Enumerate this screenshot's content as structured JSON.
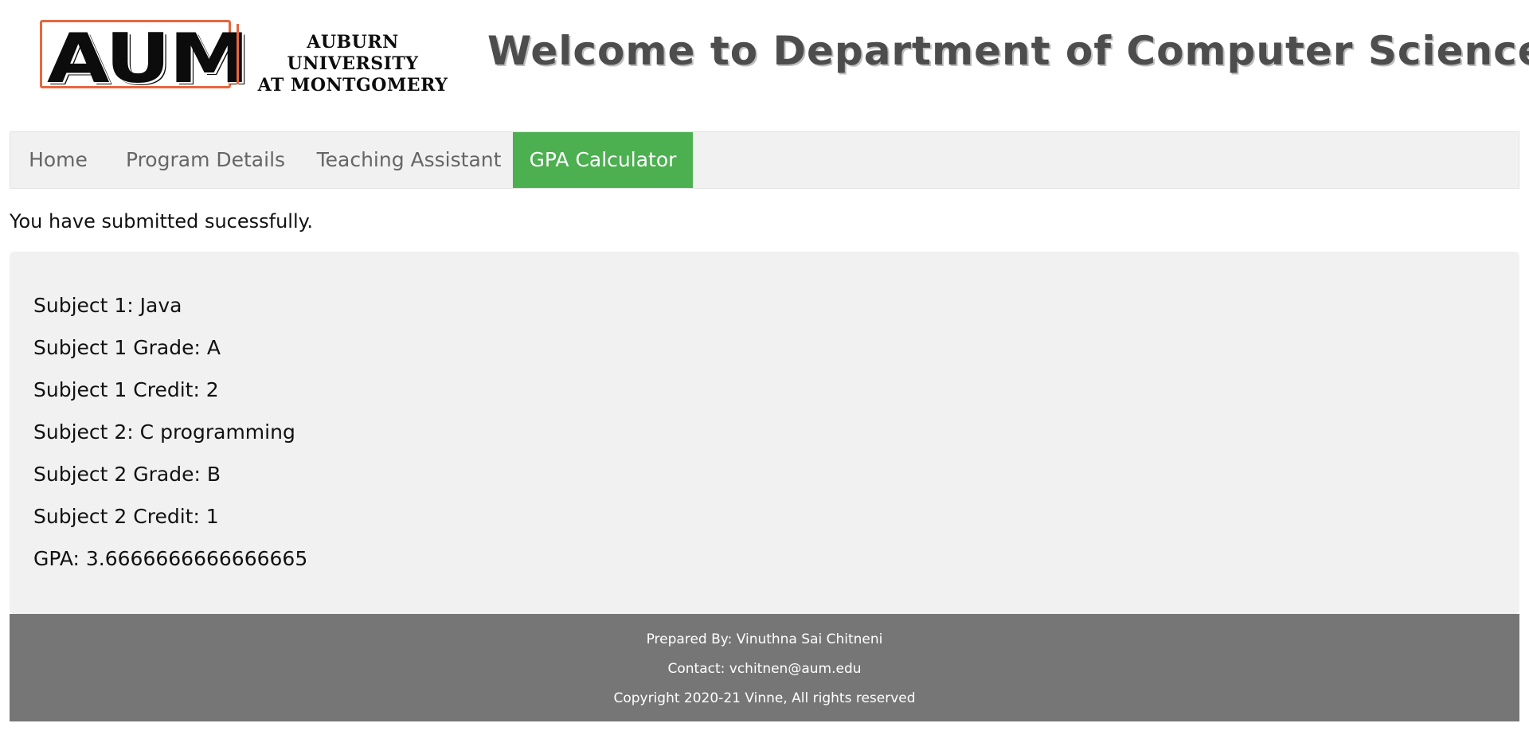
{
  "header": {
    "logo": {
      "mark": "AUM",
      "line1": "AUBURN UNIVERSITY",
      "line2": "AT MONTGOMERY"
    },
    "title": "Welcome to Department of Computer Science"
  },
  "nav": {
    "items": [
      {
        "label": "Home",
        "active": false
      },
      {
        "label": "Program Details",
        "active": false
      },
      {
        "label": "Teaching Assistant",
        "active": false
      },
      {
        "label": "GPA Calculator",
        "active": true
      }
    ],
    "active_color": "#4caf50"
  },
  "message": "You have submitted sucessfully.",
  "result": {
    "lines": [
      "Subject 1: Java",
      "Subject 1 Grade: A",
      "Subject 1 Credit: 2",
      "Subject 2: C programming",
      "Subject 2 Grade: B",
      "Subject 2 Credit: 1",
      "GPA: 3.6666666666666665"
    ]
  },
  "footer": {
    "prepared_by": "Prepared By: Vinuthna Sai Chitneni",
    "contact": "Contact: vchitnen@aum.edu",
    "copyright": "Copyright 2020-21 Vinne, All rights reserved",
    "background_color": "#767676"
  }
}
